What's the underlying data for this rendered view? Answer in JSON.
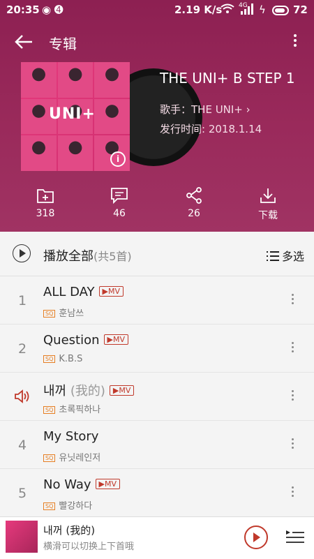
{
  "status": {
    "time": "20:35",
    "speed": "2.19 K/s",
    "battery": "72",
    "signal": "4G"
  },
  "topbar": {
    "title": "专辑"
  },
  "album": {
    "title": "THE UNI+ B STEP 1",
    "artist_label": "歌手：THE UNI+",
    "release_label": "发行时间: 2018.1.14",
    "cover_text": "UNI+"
  },
  "actions": [
    {
      "icon": "add-folder-icon",
      "label": "318"
    },
    {
      "icon": "comment-icon",
      "label": "46"
    },
    {
      "icon": "share-icon",
      "label": "26"
    },
    {
      "icon": "download-icon",
      "label": "下载"
    }
  ],
  "playall": {
    "label": "播放全部",
    "count": "(共5首)",
    "multi": "多选"
  },
  "tracks": [
    {
      "num": "1",
      "name": "ALL DAY",
      "sub": "",
      "mv": "▶MV",
      "quality": "SQ",
      "artist": "훈남쓰"
    },
    {
      "num": "2",
      "name": "Question",
      "sub": "",
      "mv": "▶MV",
      "quality": "SQ",
      "artist": "K.B.S"
    },
    {
      "num": "",
      "name": "내꺼",
      "sub": " (我的)",
      "mv": "▶MV",
      "quality": "SQ",
      "artist": "초록픽하나"
    },
    {
      "num": "4",
      "name": "My Story",
      "sub": "",
      "mv": "",
      "quality": "SQ",
      "artist": "유닛레인저"
    },
    {
      "num": "5",
      "name": "No Way",
      "sub": "",
      "mv": "▶MV",
      "quality": "SQ",
      "artist": "빨강하다"
    }
  ],
  "mini": {
    "title": "내꺼 (我的)",
    "hint": "横滑可以切换上下首哦"
  },
  "colors": {
    "header": "#9a2a5b",
    "accent": "#c0392b"
  }
}
